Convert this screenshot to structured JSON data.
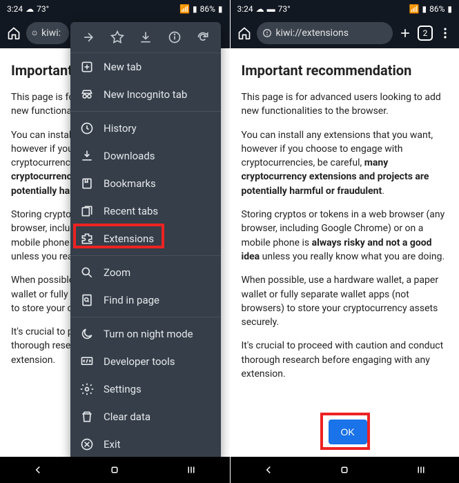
{
  "status": {
    "time": "3:24",
    "temp": "73°",
    "battery": "86%"
  },
  "left": {
    "url": "kiwi:",
    "heading": "Important",
    "p1": "This page is fo",
    "p1b": "new functionali",
    "p2a": "You can install",
    "p2b": "however if you",
    "p2c": "cryptocurrenci",
    "p2d": "cryptocurrency",
    "p2e": "potentially harm",
    "p3a": "Storing cryptos",
    "p3b": "browser, includ",
    "p3c": "mobile phone",
    "p3d": "unless you rea",
    "p4a": "When possible",
    "p4b": "wallet or fully s",
    "p4c": "to store your c",
    "p5a": "It's crucial to p",
    "p5b": "thorough resea",
    "p5c": "extension."
  },
  "menu": {
    "items": [
      "New tab",
      "New Incognito tab",
      "History",
      "Downloads",
      "Bookmarks",
      "Recent tabs",
      "Extensions",
      "Zoom",
      "Find in page",
      "Turn on night mode",
      "Developer tools",
      "Settings",
      "Clear data",
      "Exit"
    ]
  },
  "right": {
    "url": "kiwi://extensions",
    "tab_count": "2",
    "heading": "Important recommendation",
    "p1": "This page is for advanced users looking to add new functionalities to the browser.",
    "p2a": "You can install any extensions that you want, however if you choose to engage with cryptocurrencies, be careful, ",
    "p2b": "many cryptocurrency extensions and projects are potentially harmful or fraudulent",
    "p3a": "Storing cryptos or tokens in a web browser (any browser, including Google Chrome) or on a mobile phone is ",
    "p3b": "always risky and not a good idea",
    "p3c": " unless you really know what you are doing.",
    "p4": "When possible, use a hardware wallet, a paper wallet or fully separate wallet apps (not browsers) to store your cryptocurrency assets securely.",
    "p5": "It's crucial to proceed with caution and conduct thorough research before engaging with any extension.",
    "ok": "OK"
  }
}
